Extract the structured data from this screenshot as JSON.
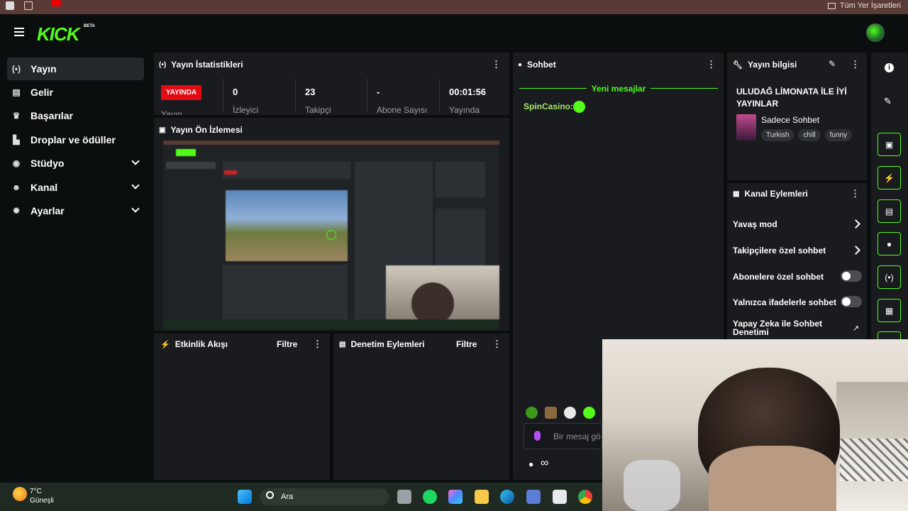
{
  "browser": {
    "bookmarks_all_label": "Tüm Yer İşaretleri"
  },
  "app": {
    "logo": "KICK",
    "logo_badge": "BETA"
  },
  "sidebar": {
    "items": [
      {
        "label": "Yayın",
        "icon": "broadcast-icon",
        "active": true
      },
      {
        "label": "Gelir",
        "icon": "revenue-icon"
      },
      {
        "label": "Başarılar",
        "icon": "trophy-icon"
      },
      {
        "label": "Droplar ve ödüller",
        "icon": "chart-icon"
      },
      {
        "label": "Stüdyo",
        "icon": "studio-icon",
        "expandable": true
      },
      {
        "label": "Kanal",
        "icon": "users-icon",
        "expandable": true
      },
      {
        "label": "Ayarlar",
        "icon": "gear-icon",
        "expandable": true
      }
    ]
  },
  "stats": {
    "title": "Yayın İstatistikleri",
    "live_badge": "YAYINDA",
    "first_label": "Yayın",
    "items": [
      {
        "value": "0",
        "label": "İzleyici"
      },
      {
        "value": "23",
        "label": "Takipçi"
      },
      {
        "value": "-",
        "label": "Abone Sayısı"
      },
      {
        "value": "00:01:56",
        "label": "Yayında"
      }
    ]
  },
  "preview": {
    "title": "Yayın Ön İzlemesi"
  },
  "activity": {
    "title": "Etkinlik Akışı",
    "filter": "Filtre"
  },
  "moderation": {
    "title": "Denetim Eylemleri",
    "filter": "Filtre"
  },
  "chat": {
    "title": "Sohbet",
    "new_messages": "Yeni mesajlar",
    "messages": [
      {
        "user": "SpinCasino:",
        "user_color": "#a4e86b"
      }
    ],
    "input_placeholder": "Bir mesaj gö",
    "footer_symbol": "∞"
  },
  "stream_info": {
    "title": "Yayın bilgisi",
    "stream_title": "ULUDAĞ LİMONATA İLE İYİ YAYINLAR",
    "category": "Sadece Sohbet",
    "tags": [
      "Turkish",
      "chill",
      "funny"
    ]
  },
  "channel_actions": {
    "title": "Kanal Eylemleri",
    "rows": [
      {
        "label": "Yavaş mod",
        "type": "arrow"
      },
      {
        "label": "Takipçilere özel sohbet",
        "type": "arrow"
      },
      {
        "label": "Abonelere özel sohbet",
        "type": "toggle",
        "on": false
      },
      {
        "label": "Yalnızca ifadelerle sohbet",
        "type": "toggle",
        "on": false
      },
      {
        "label": "Yapay Zeka ile Sohbet Denetimi",
        "type": "external"
      }
    ]
  },
  "taskbar": {
    "weather_temp": "7°C",
    "weather_desc": "Güneşli",
    "search_label": "Ara"
  },
  "colors": {
    "accent": "#53fc18",
    "live": "#e30b13",
    "panel": "#191b1f"
  }
}
